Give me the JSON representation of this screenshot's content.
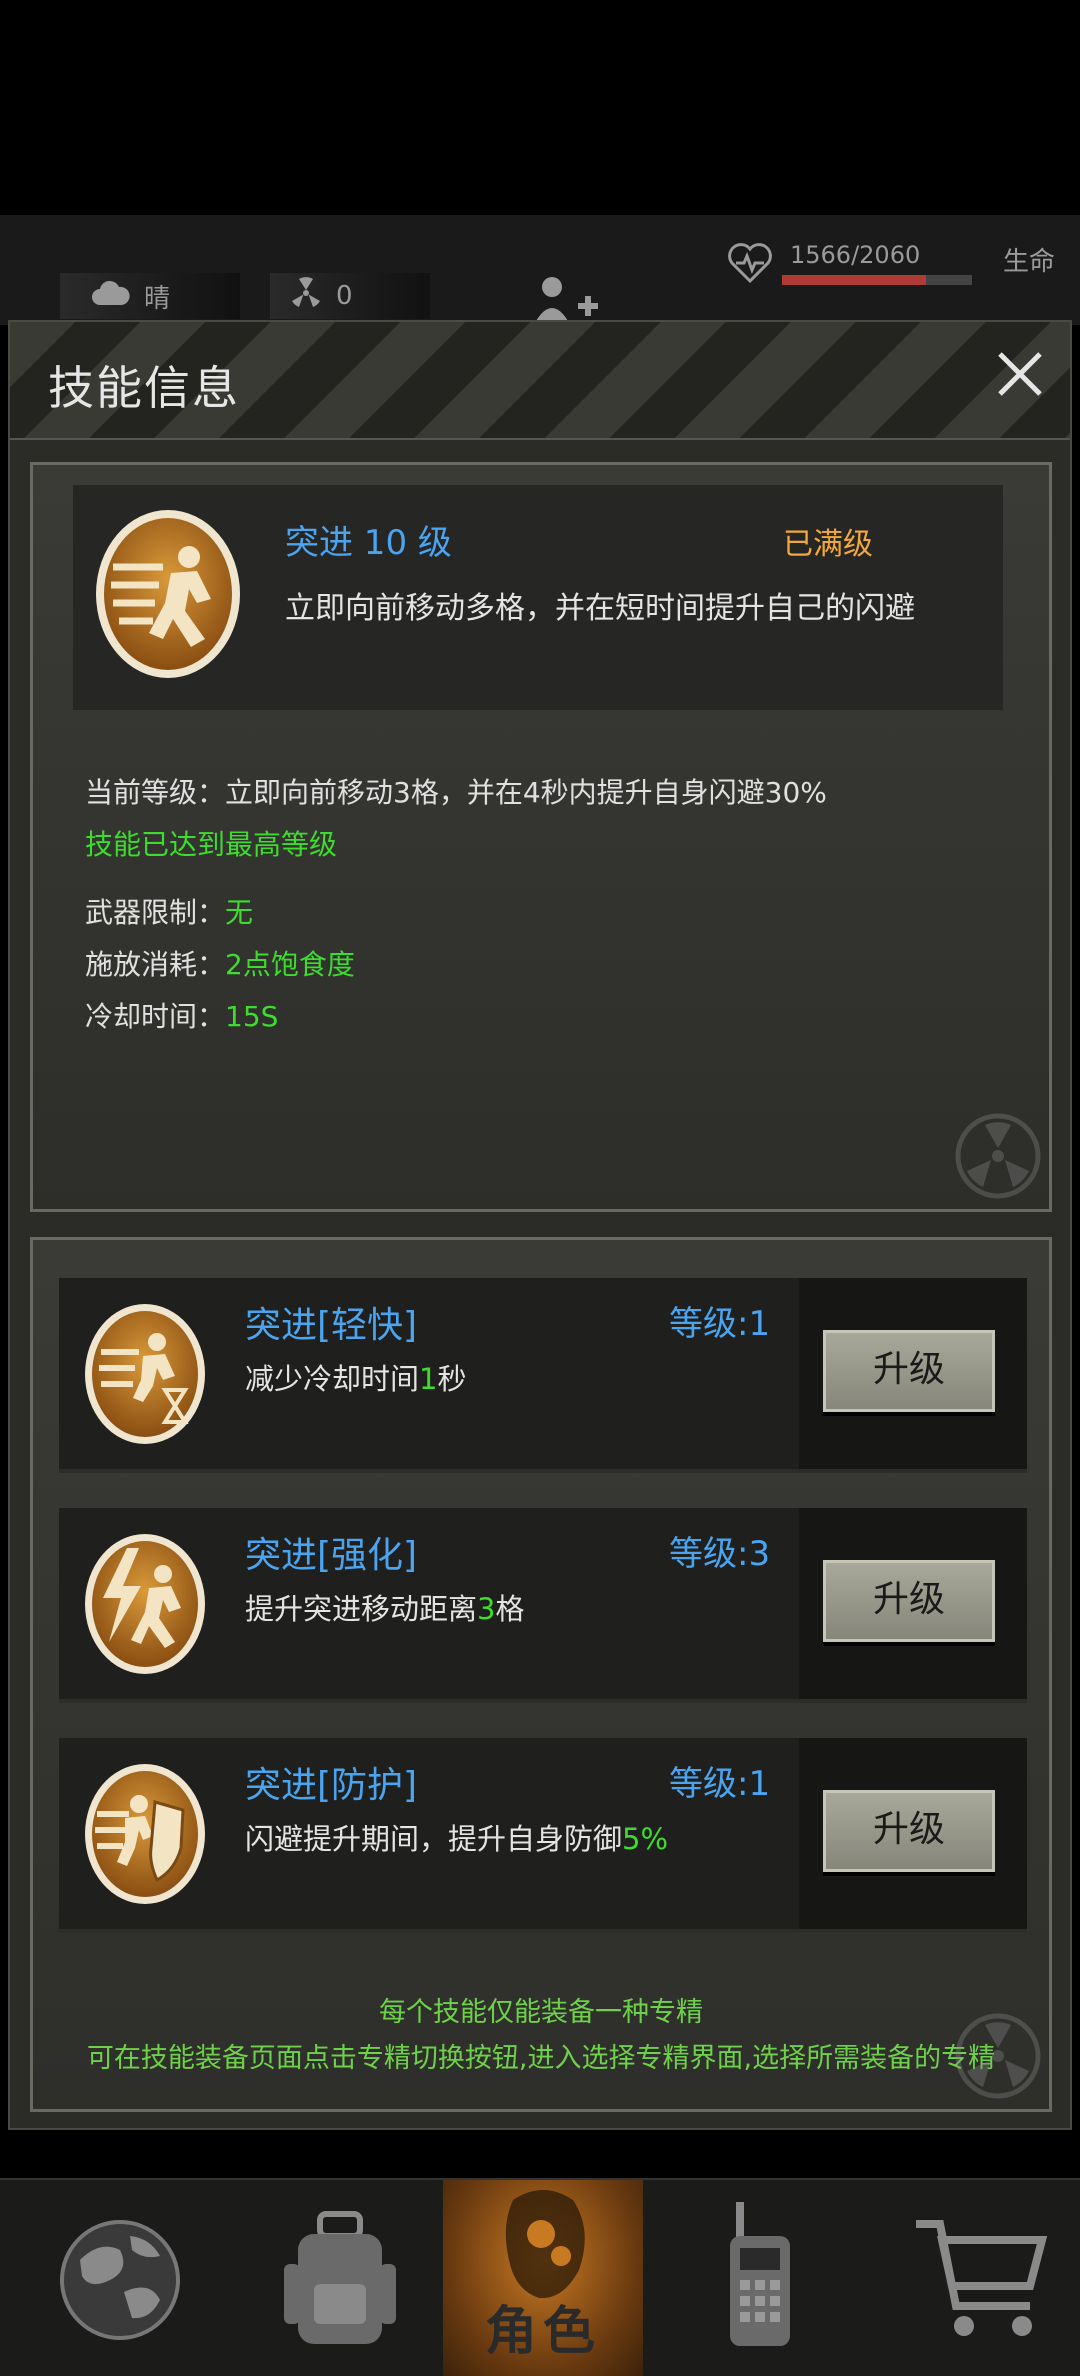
{
  "status_bar": {
    "weather": "晴",
    "radiation": "0",
    "hp_text": "1566/2060",
    "hp_label": "生命",
    "hp_fraction": 0.76
  },
  "modal": {
    "title": "技能信息"
  },
  "skill": {
    "name": "突进 10 级",
    "max_label": "已满级",
    "desc": "立即向前移动多格，并在短时间提升自己的闪避",
    "current_level_label": "当前等级：",
    "current_level_text": "立即向前移动3格，并在4秒内提升自身闪避30%",
    "max_reached": "技能已达到最高等级",
    "weapon_label": "武器限制：",
    "weapon_value": "无",
    "cost_label": "施放消耗：",
    "cost_value": "2点饱食度",
    "cooldown_label": "冷却时间：",
    "cooldown_value": "15S"
  },
  "specs": [
    {
      "name": "突进[轻快]",
      "level": "等级:1",
      "desc_pre": "减少冷却时间",
      "desc_num": "1",
      "desc_post": "秒",
      "button": "升级"
    },
    {
      "name": "突进[强化]",
      "level": "等级:3",
      "desc_pre": "提升突进移动距离",
      "desc_num": "3",
      "desc_post": "格",
      "button": "升级"
    },
    {
      "name": "突进[防护]",
      "level": "等级:1",
      "desc_pre": "闪避提升期间，提升自身防御",
      "desc_num": "5%",
      "desc_post": "",
      "button": "升级"
    }
  ],
  "tips": {
    "line1": "每个技能仅能装备一种专精",
    "line2": "可在技能装备页面点击专精切换按钮,进入选择专精界面,选择所需装备的专精"
  },
  "nav": {
    "active_label": "角色"
  },
  "colors": {
    "skill_name": "#4aa4f0",
    "max_level": "#f2a83a",
    "highlight_green": "#3ddc2e",
    "active_tab": "#c87a22"
  }
}
